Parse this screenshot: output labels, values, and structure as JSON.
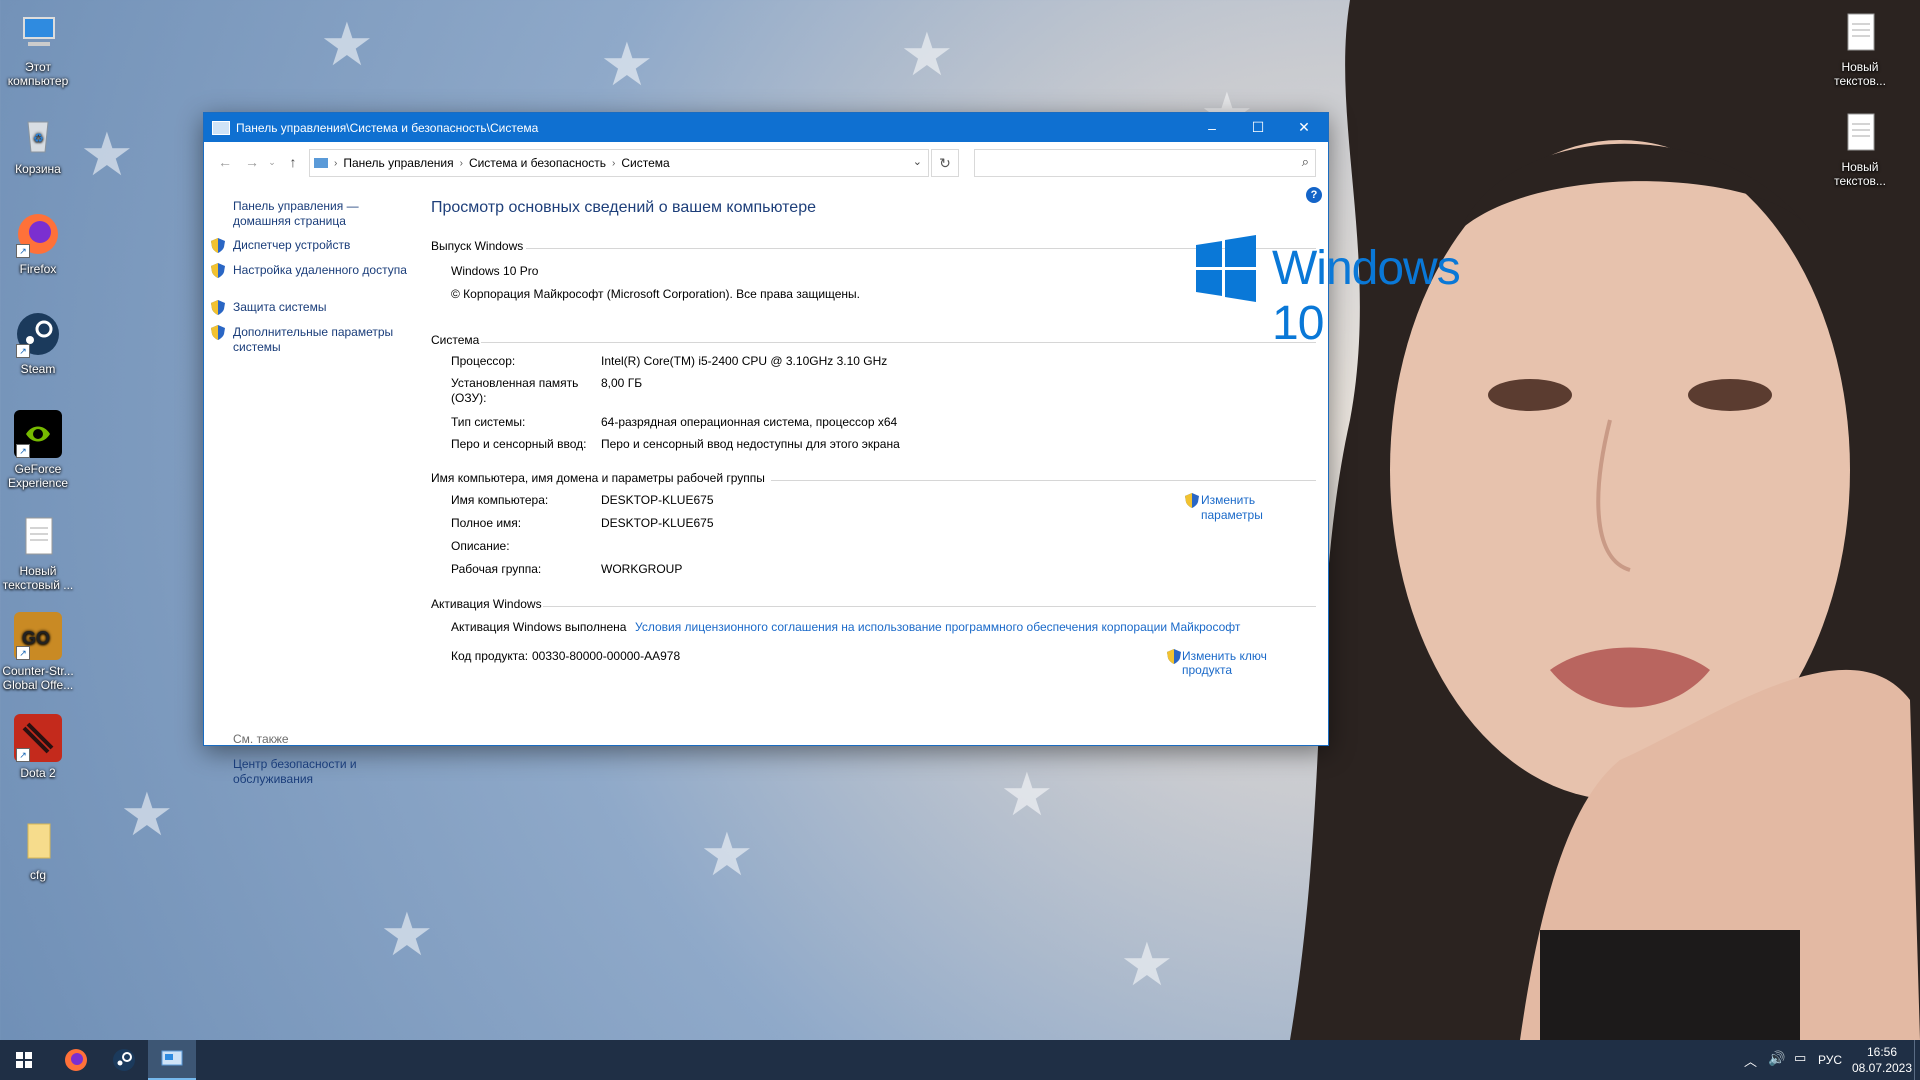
{
  "desktop": {
    "icons_left": [
      {
        "label": "Этот компьютер",
        "icon": "computer-icon"
      },
      {
        "label": "Корзина",
        "icon": "recycle-bin-icon"
      },
      {
        "label": "Firefox",
        "icon": "firefox-icon"
      },
      {
        "label": "Steam",
        "icon": "steam-icon"
      },
      {
        "label": "GeForce Experience",
        "icon": "geforce-icon"
      },
      {
        "label": "Новый текстовый ...",
        "icon": "text-file-icon"
      },
      {
        "label": "Counter-Str... Global Offe...",
        "icon": "csgo-icon"
      },
      {
        "label": "Dota 2",
        "icon": "dota2-icon"
      },
      {
        "label": "cfg",
        "icon": "folder-icon"
      }
    ],
    "icons_right": [
      {
        "label": "Новый текстов...",
        "icon": "text-file-icon"
      },
      {
        "label": "Новый текстов...",
        "icon": "text-file-icon"
      }
    ]
  },
  "window": {
    "title": "Панель управления\\Система и безопасность\\Система",
    "breadcrumb": [
      "Панель управления",
      "Система и безопасность",
      "Система"
    ],
    "search_placeholder": "",
    "left_nav": {
      "home": "Панель управления — домашняя страница",
      "items": [
        "Диспетчер устройств",
        "Настройка удаленного доступа",
        "Защита системы",
        "Дополнительные параметры системы"
      ],
      "see_also_title": "См. также",
      "see_also_link": "Центр безопасности и обслуживания"
    },
    "main": {
      "heading": "Просмотр основных сведений о вашем компьютере",
      "edition": {
        "title": "Выпуск Windows",
        "name": "Windows 10 Pro",
        "copyright": "© Корпорация Майкрософт (Microsoft Corporation). Все права защищены.",
        "logo_text": "Windows 10"
      },
      "system": {
        "title": "Система",
        "rows": [
          {
            "label": "Процессор:",
            "value": "Intel(R) Core(TM) i5-2400 CPU @ 3.10GHz   3.10 GHz"
          },
          {
            "label": "Установленная память (ОЗУ):",
            "value": "8,00 ГБ"
          },
          {
            "label": "Тип системы:",
            "value": "64-разрядная операционная система, процессор x64"
          },
          {
            "label": "Перо и сенсорный ввод:",
            "value": "Перо и сенсорный ввод недоступны для этого экрана"
          }
        ]
      },
      "computer": {
        "title": "Имя компьютера, имя домена и параметры рабочей группы",
        "rows": [
          {
            "label": "Имя компьютера:",
            "value": "DESKTOP-KLUE675"
          },
          {
            "label": "Полное имя:",
            "value": "DESKTOP-KLUE675"
          },
          {
            "label": "Описание:",
            "value": ""
          },
          {
            "label": "Рабочая группа:",
            "value": "WORKGROUP"
          }
        ],
        "change_link": "Изменить параметры"
      },
      "activation": {
        "title": "Активация Windows",
        "status": "Активация Windows выполнена",
        "license_link": "Условия лицензионного соглашения на использование программного обеспечения корпорации Майкрософт",
        "product_key_label": "Код продукта:",
        "product_key": "00330-80000-00000-AA978",
        "change_key_link": "Изменить ключ продукта"
      }
    }
  },
  "taskbar": {
    "lang": "РУС",
    "time": "16:56",
    "date": "08.07.2023",
    "accent": "#0f70d1"
  }
}
